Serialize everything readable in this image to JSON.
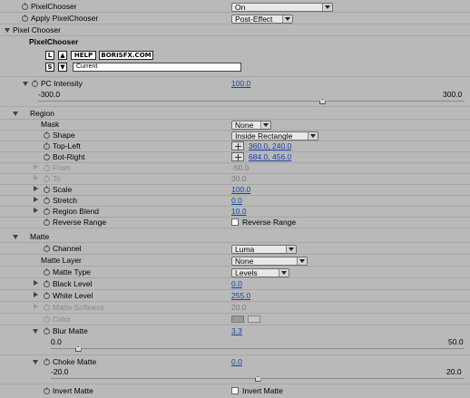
{
  "effect": {
    "pixel_chooser": {
      "label": "PixelChooser",
      "value": "On"
    },
    "apply_pixel_chooser": {
      "label": "Apply PixelChooser",
      "value": "Post-Effect"
    },
    "section_pixel_chooser": "Pixel Chooser",
    "pc_header": "PixelChooser",
    "pc_buttons": {
      "l": "L",
      "up": "▲",
      "help": "HELP",
      "site": "BORISFX.COM",
      "s": "S",
      "down": "▼"
    },
    "pc_current_value": "Current",
    "pc_intensity": {
      "label": "PC Intensity",
      "value": "100.0",
      "min": "-300.0",
      "max": "300.0",
      "fraction": 0.6667
    }
  },
  "region": {
    "title": "Region",
    "mask": {
      "label": "Mask",
      "value": "None"
    },
    "shape": {
      "label": "Shape",
      "value": "Inside Rectangle"
    },
    "top_left": {
      "label": "Top-Left",
      "value": "360.0, 240.0"
    },
    "bot_right": {
      "label": "Bot-Right",
      "value": "684.0, 456.0"
    },
    "from": {
      "label": "From",
      "value": "-50.0"
    },
    "to": {
      "label": "To",
      "value": "30.0"
    },
    "scale": {
      "label": "Scale",
      "value": "100.0"
    },
    "stretch": {
      "label": "Stretch",
      "value": "0.0"
    },
    "region_blend": {
      "label": "Region Blend",
      "value": "10.0"
    },
    "reverse_range": {
      "label": "Reverse Range",
      "checkbox_label": "Reverse Range",
      "checked": false
    }
  },
  "matte": {
    "title": "Matte",
    "channel": {
      "label": "Channel",
      "value": "Luma"
    },
    "matte_layer": {
      "label": "Matte Layer",
      "value": "None"
    },
    "matte_type": {
      "label": "Matte Type",
      "value": "Levels"
    },
    "black_level": {
      "label": "Black Level",
      "value": "0.0"
    },
    "white_level": {
      "label": "White Level",
      "value": "255.0"
    },
    "matte_softness": {
      "label": "Matte Softness",
      "value": "20.0"
    },
    "color": {
      "label": "Color",
      "swatch": "#9a9a9a"
    },
    "blur_matte": {
      "label": "Blur Matte",
      "value": "3.3",
      "min": "0.0",
      "max": "50.0",
      "fraction": 0.066
    },
    "choke_matte": {
      "label": "Choke Matte",
      "value": "0.0",
      "min": "-20.0",
      "max": "20.0",
      "fraction": 0.5
    },
    "invert_matte": {
      "label": "Invert Matte",
      "checkbox_label": "Invert Matte",
      "checked": false
    }
  },
  "colors": {
    "panel_bg": "#b9b9b9",
    "value_blue": "#1a3fa8",
    "disabled": "#8a8a8a"
  }
}
